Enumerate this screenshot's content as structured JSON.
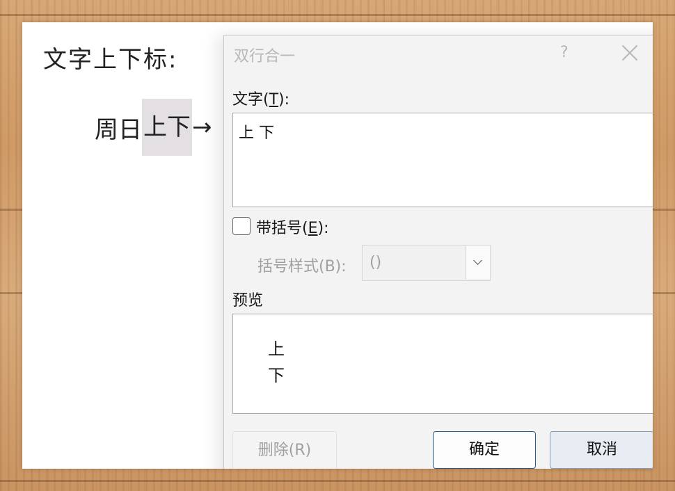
{
  "document": {
    "heading": "文字上下标:",
    "line_prefix": "周日",
    "selected_text": "上下",
    "arrow": "→"
  },
  "dialog": {
    "title": "双行合一",
    "help_symbol": "?",
    "text_label": {
      "prefix": "文字(",
      "key": "T",
      "suffix": "):"
    },
    "text_value": "上 下",
    "checkbox": {
      "checked": false,
      "label_prefix": "带括号(",
      "key": "E",
      "label_suffix": "):"
    },
    "bracket_style": {
      "label": "括号样式(B):",
      "value": "()",
      "enabled": false
    },
    "preview_label": "预览",
    "preview": {
      "top": "上",
      "bottom": "下"
    },
    "buttons": {
      "delete": "删除(R)",
      "ok": "确定",
      "cancel": "取消"
    }
  },
  "colors": {
    "selection": "#e4dfe3",
    "ok_border": "#2a5d8f",
    "disabled_text": "#a0a0a0"
  }
}
